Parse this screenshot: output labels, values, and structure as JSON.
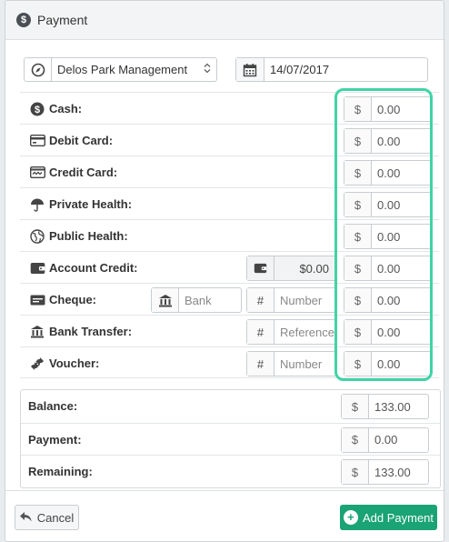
{
  "title": "Payment",
  "practice": {
    "value": "Delos Park Management"
  },
  "date": {
    "value": "14/07/2017"
  },
  "currency_symbol": "$",
  "methods": [
    {
      "label": "Cash:",
      "amount": "0.00"
    },
    {
      "label": "Debit Card:",
      "amount": "0.00"
    },
    {
      "label": "Credit Card:",
      "amount": "0.00"
    },
    {
      "label": "Private Health:",
      "amount": "0.00"
    },
    {
      "label": "Public Health:",
      "amount": "0.00"
    },
    {
      "label": "Account Credit:",
      "amount": "0.00",
      "credit_value": "$0.00"
    },
    {
      "label": "Cheque:",
      "amount": "0.00",
      "bank_placeholder": "Bank",
      "number_placeholder": "Number"
    },
    {
      "label": "Bank Transfer:",
      "amount": "0.00",
      "reference_placeholder": "Reference"
    },
    {
      "label": "Voucher:",
      "amount": "0.00",
      "number_placeholder": "Number"
    }
  ],
  "summary": [
    {
      "label": "Balance:",
      "amount": "133.00"
    },
    {
      "label": "Payment:",
      "amount": "0.00"
    },
    {
      "label": "Remaining:",
      "amount": "133.00"
    }
  ],
  "buttons": {
    "cancel": "Cancel",
    "add": "Add Payment"
  },
  "hash_symbol": "#",
  "colors": {
    "highlight": "#40d4a6",
    "primary": "#1aa375"
  }
}
